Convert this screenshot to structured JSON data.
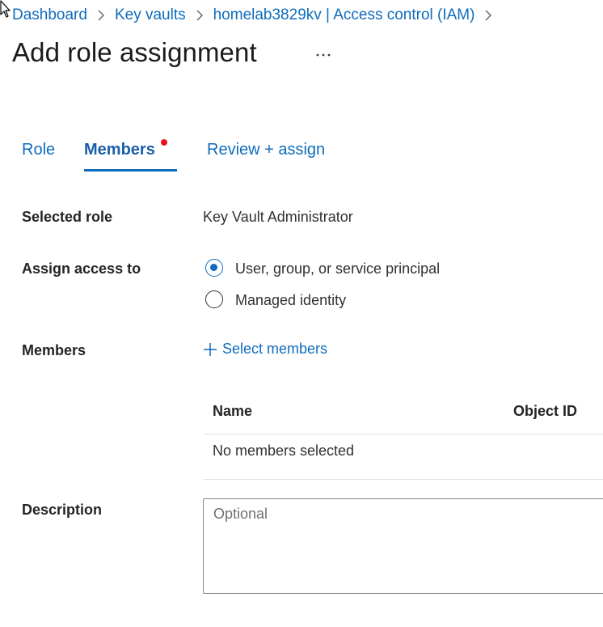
{
  "breadcrumb": {
    "items": [
      "Dashboard",
      "Key vaults",
      "homelab3829kv | Access control (IAM)"
    ]
  },
  "page": {
    "title": "Add role assignment",
    "more_label": "..."
  },
  "tabs": {
    "role": "Role",
    "members": "Members",
    "review": "Review + assign",
    "active": "members"
  },
  "form": {
    "selected_role_label": "Selected role",
    "selected_role_value": "Key Vault Administrator",
    "assign_access_label": "Assign access to",
    "assign_options": [
      {
        "label": "User, group, or service principal",
        "checked": true
      },
      {
        "label": "Managed identity",
        "checked": false
      }
    ],
    "members_label": "Members",
    "select_members_link": "Select members",
    "table": {
      "columns": [
        "Name",
        "Object ID"
      ],
      "empty_text": "No members selected"
    },
    "description_label": "Description",
    "description_placeholder": "Optional"
  },
  "colors": {
    "link": "#0f6cbd",
    "accent": "#0f6cbd",
    "required_dot": "#e81123"
  },
  "icons": [
    "cursor-arrow-icon",
    "chevron-right-icon",
    "more-horizontal-icon",
    "plus-icon"
  ]
}
